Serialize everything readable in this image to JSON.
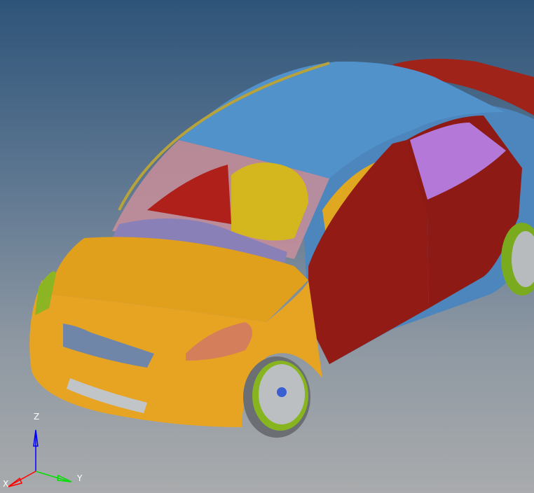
{
  "viewport": {
    "model": "car-body-assembly",
    "colors": {
      "roof": "#4f8fc8",
      "hood": "#e3a21e",
      "door": "#8f1a14",
      "seat": "#d8b51e",
      "interior": "#b06ad0",
      "wheel_rim": "#b9bcbf",
      "tire_ring": "#86b520",
      "headlamp": "#d47a5a"
    }
  },
  "axis_triad": {
    "z_label": "Z",
    "y_label": "Y",
    "x_label": "X",
    "colors": {
      "x": "#ff0000",
      "y": "#00e000",
      "z": "#0000ff"
    }
  }
}
